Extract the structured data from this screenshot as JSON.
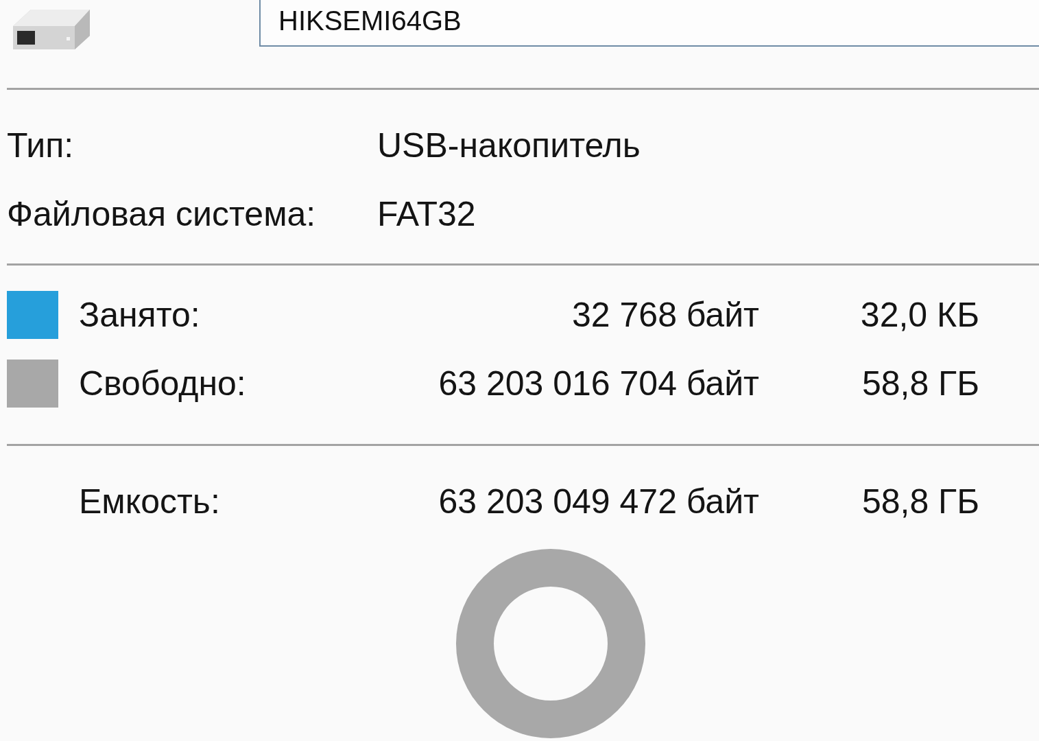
{
  "drive": {
    "name": "HIKSEMI64GB"
  },
  "info": [
    {
      "label": "Тип:",
      "value": "USB-накопитель"
    },
    {
      "label": "Файловая система:",
      "value": "FAT32"
    }
  ],
  "space": [
    {
      "label": "Занято:",
      "bytes": "32 768 байт",
      "size": "32,0 КБ",
      "color": "#269fdb"
    },
    {
      "label": "Свободно:",
      "bytes": "63 203 016 704 байт",
      "size": "58,8 ГБ",
      "color": "#a8a8a8"
    }
  ],
  "capacity": {
    "label": "Емкость:",
    "bytes": "63 203 049 472 байт",
    "size": "58,8 ГБ"
  }
}
